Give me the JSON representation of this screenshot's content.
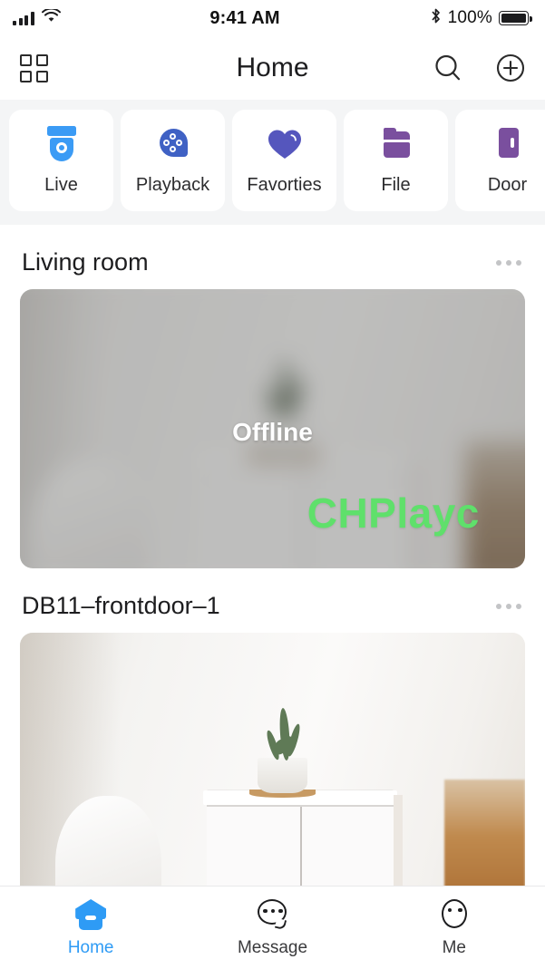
{
  "status_bar": {
    "signal_icon": "cellular-signal-icon",
    "wifi_icon": "wifi-icon",
    "time": "9:41 AM",
    "bluetooth_icon": "bluetooth-icon",
    "battery_percent": "100%",
    "battery_icon": "battery-full-icon"
  },
  "nav": {
    "grid_icon": "grid-menu-icon",
    "title": "Home",
    "search_icon": "search-icon",
    "add_icon": "add-circle-icon"
  },
  "quick_actions": [
    {
      "label": "Live",
      "icon": "dome-camera-icon",
      "color": "#3b9bf5"
    },
    {
      "label": "Playback",
      "icon": "playback-bubble-icon",
      "color": "#3f61c4"
    },
    {
      "label": "Favorties",
      "icon": "heart-icon",
      "color": "#5556bd"
    },
    {
      "label": "File",
      "icon": "folder-icon",
      "color": "#7a4f9e"
    },
    {
      "label": "Door",
      "icon": "door-icon",
      "color": "#7a4f9e"
    }
  ],
  "cameras": [
    {
      "title": "Living room",
      "menu_icon": "more-options-icon",
      "status_label": "Offline",
      "watermark": "CHPlayc",
      "watermark_color": "#5fe06b",
      "state": "offline"
    },
    {
      "title": "DB11–frontdoor–1",
      "menu_icon": "more-options-icon",
      "status_label": "",
      "watermark": "",
      "state": "online"
    }
  ],
  "tabbar": [
    {
      "label": "Home",
      "icon": "home-icon",
      "active": true
    },
    {
      "label": "Message",
      "icon": "message-icon",
      "active": false
    },
    {
      "label": "Me",
      "icon": "profile-icon",
      "active": false
    }
  ],
  "theme": {
    "accent_blue": "#2e9bf5",
    "purple": "#7a4f9e",
    "indigo": "#3f61c4",
    "green": "#5fe06b",
    "quickbar_bg": "#f4f5f6"
  }
}
